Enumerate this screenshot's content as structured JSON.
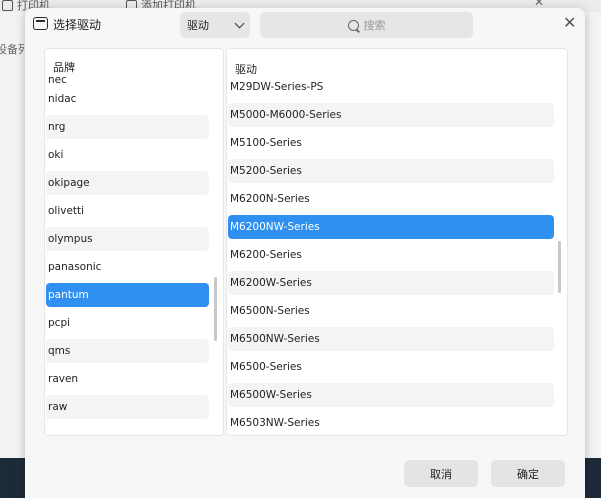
{
  "background": {
    "title_left": "打印机",
    "title_right": "添加打印机",
    "side_text": "设备列"
  },
  "dialog": {
    "title": "选择驱动",
    "dropdown_value": "驱动",
    "search_placeholder": "搜索",
    "brand_header": "品牌",
    "driver_header": "驱动",
    "brand_cut": "nec",
    "brands": [
      "nidac",
      "nrg",
      "oki",
      "okipage",
      "olivetti",
      "olympus",
      "panasonic",
      "pantum",
      "pcpi",
      "qms",
      "raven",
      "raw"
    ],
    "selected_brand": "pantum",
    "drivers": [
      "M29DW-Series-PS",
      "M5000-M6000-Series",
      "M5100-Series",
      "M5200-Series",
      "M6200N-Series",
      "M6200NW-Series",
      "M6200-Series",
      "M6200W-Series",
      "M6500N-Series",
      "M6500NW-Series",
      "M6500-Series",
      "M6500W-Series",
      "M6503NW-Series"
    ],
    "selected_driver": "M6200NW-Series",
    "cancel_label": "取消",
    "ok_label": "确定"
  },
  "colors": {
    "accent": "#2f90f2"
  }
}
